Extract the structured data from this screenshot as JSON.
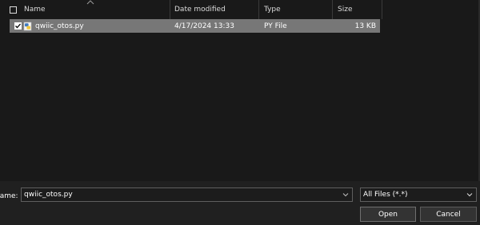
{
  "columns": {
    "name": "Name",
    "date_modified": "Date modified",
    "type": "Type",
    "size": "Size"
  },
  "files": [
    {
      "name": "qwiic_otos.py",
      "date_modified": "4/17/2024 13:33",
      "type": "PY File",
      "size": "13 KB",
      "selected": true,
      "icon": "python-file-icon"
    }
  ],
  "file_name": {
    "label": "name:",
    "value": "qwiic_otos.py"
  },
  "filter": {
    "selected": "All Files (*.*)"
  },
  "buttons": {
    "open": "Open",
    "cancel": "Cancel"
  },
  "colors": {
    "background": "#191919",
    "selected_row": "#777777",
    "footer": "#202020"
  }
}
